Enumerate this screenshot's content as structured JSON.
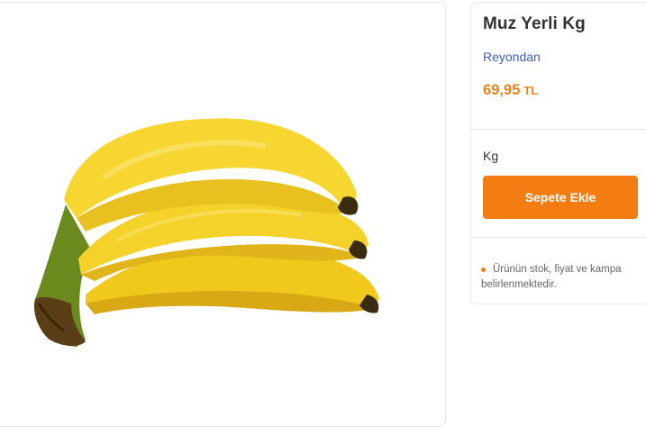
{
  "product": {
    "title": "Muz Yerli Kg",
    "brand_link": "Reyondan",
    "price": "69,95",
    "currency": "TL",
    "unit": "Kg",
    "add_to_cart_label": "Sepete Ekle",
    "note_line1": "Ürünün stok, fiyat ve kampa",
    "note_line2": "belirlenmektedir."
  },
  "colors": {
    "accent": "#f47d13",
    "price": "#f0821e",
    "link": "#3d5bbd"
  },
  "icons": {
    "note_bullet": "dot-icon"
  }
}
